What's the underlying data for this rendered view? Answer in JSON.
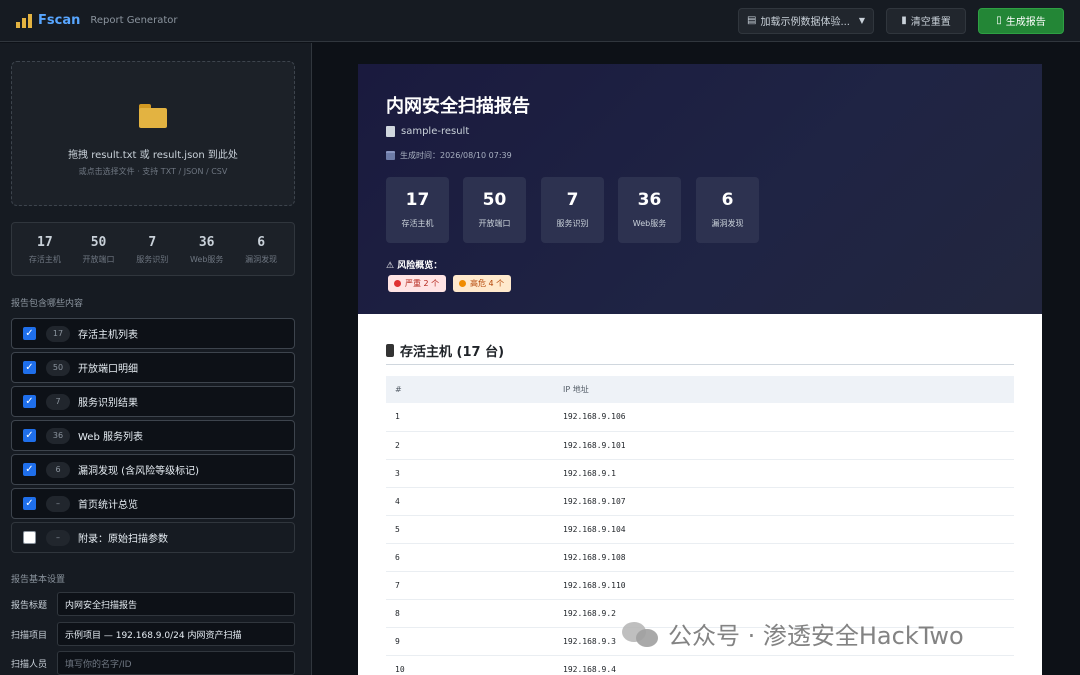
{
  "app": {
    "title": "Fscan",
    "subtitle": "Report Generator"
  },
  "toolbar": {
    "sample_select": "加载示例数据体验...",
    "clear_label": "清空重置",
    "generate_label": "生成报告"
  },
  "upload": {
    "main_text": "拖拽 result.txt 或 result.json 到此处",
    "sub_text": "或点击选择文件 · 支持 TXT / JSON / CSV"
  },
  "stats": [
    {
      "value": "17",
      "label": "存活主机"
    },
    {
      "value": "50",
      "label": "开放端口"
    },
    {
      "value": "7",
      "label": "服务识别"
    },
    {
      "value": "36",
      "label": "Web服务"
    },
    {
      "value": "6",
      "label": "漏洞发现"
    }
  ],
  "content_section": {
    "title": "报告包含哪些内容",
    "options": [
      {
        "count": "17",
        "label": "存活主机列表",
        "checked": true
      },
      {
        "count": "50",
        "label": "开放端口明细",
        "checked": true
      },
      {
        "count": "7",
        "label": "服务识别结果",
        "checked": true
      },
      {
        "count": "36",
        "label": "Web 服务列表",
        "checked": true
      },
      {
        "count": "6",
        "label": "漏洞发现 (含风险等级标记)",
        "checked": true
      },
      {
        "count": "–",
        "label": "首页统计总览",
        "checked": true
      },
      {
        "count": "–",
        "label": "附录：原始扫描参数",
        "checked": false
      }
    ]
  },
  "settings": {
    "title": "报告基本设置",
    "fields": [
      {
        "label": "报告标题",
        "value": "内网安全扫描报告",
        "placeholder": ""
      },
      {
        "label": "扫描项目",
        "value": "示例项目 — 192.168.9.0/24 内网资产扫描",
        "placeholder": ""
      },
      {
        "label": "扫描人员",
        "value": "",
        "placeholder": "填写你的名字/ID"
      }
    ]
  },
  "report": {
    "title": "内网安全扫描报告",
    "source": "sample-result",
    "time_label": "生成时间：2026/08/10 07:39",
    "cards": [
      {
        "value": "17",
        "label": "存活主机"
      },
      {
        "value": "50",
        "label": "开放端口"
      },
      {
        "value": "7",
        "label": "服务识别"
      },
      {
        "value": "36",
        "label": "Web服务"
      },
      {
        "value": "6",
        "label": "漏洞发现"
      }
    ],
    "risk_title": "⚠ 风险概览：",
    "risk_badges": {
      "severe": "严重 2 个",
      "high": "高危 4 个"
    },
    "hosts_heading": "存活主机 (17 台)",
    "table": {
      "columns": [
        "#",
        "IP 地址"
      ],
      "rows": [
        [
          "1",
          "192.168.9.106"
        ],
        [
          "2",
          "192.168.9.101"
        ],
        [
          "3",
          "192.168.9.1"
        ],
        [
          "4",
          "192.168.9.107"
        ],
        [
          "5",
          "192.168.9.104"
        ],
        [
          "6",
          "192.168.9.108"
        ],
        [
          "7",
          "192.168.9.110"
        ],
        [
          "8",
          "192.168.9.2"
        ],
        [
          "9",
          "192.168.9.3"
        ],
        [
          "10",
          "192.168.9.4"
        ]
      ]
    }
  },
  "watermark": "公众号 · 渗透安全HackTwo",
  "colors": {
    "accent": "#58a6ff",
    "primary_button": "#238636",
    "checkbox": "#1f6feb",
    "hero_bg": "#1a1a3e"
  }
}
